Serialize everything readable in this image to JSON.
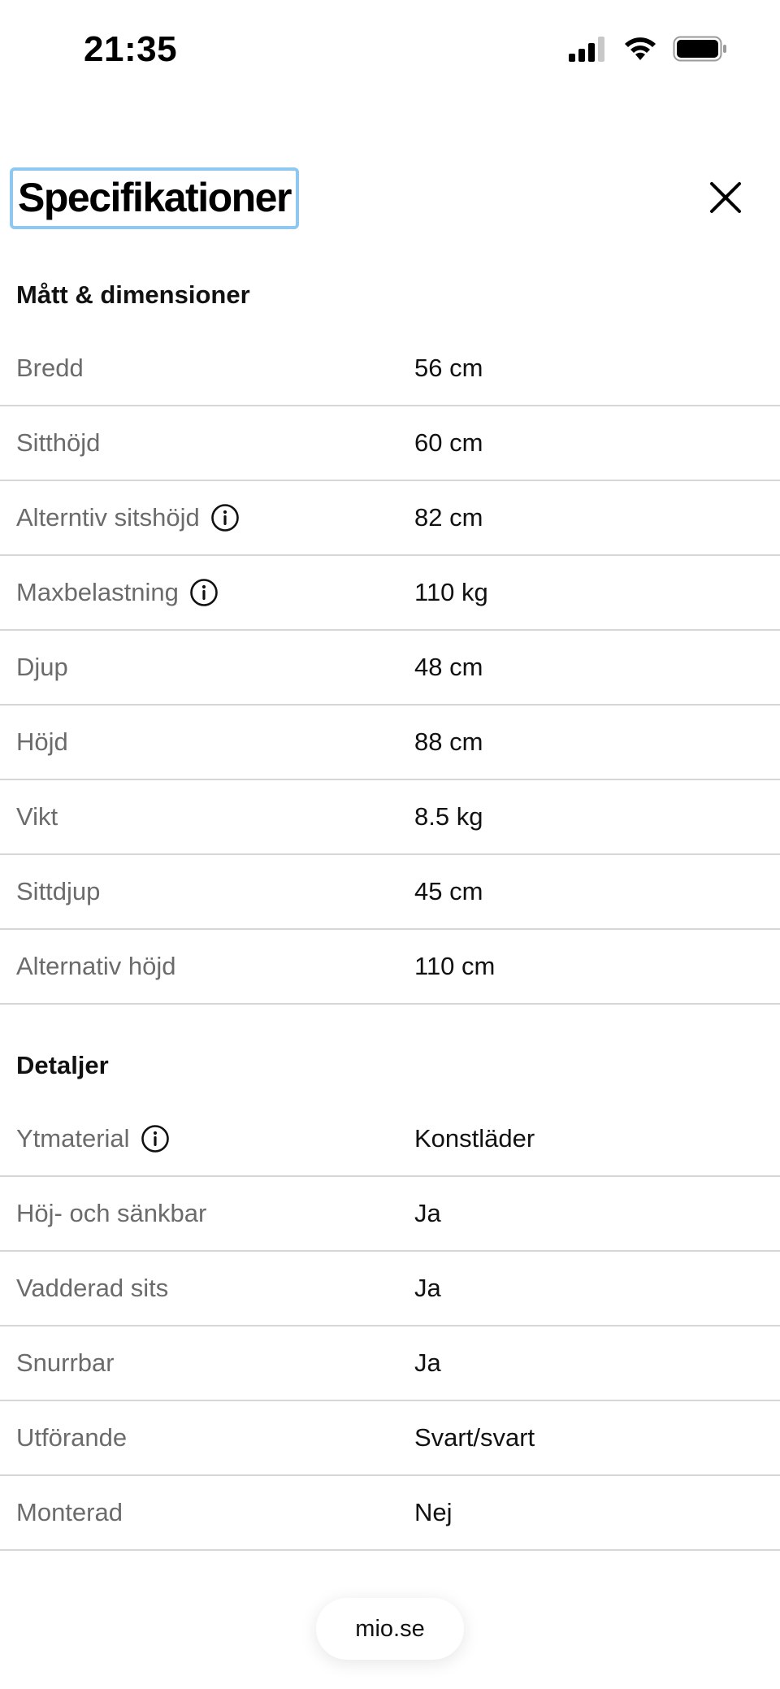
{
  "status_bar": {
    "time": "21:35",
    "icons": [
      "signal-icon",
      "wifi-icon",
      "battery-icon"
    ]
  },
  "header": {
    "title": "Specifikationer",
    "close_icon": "close-icon"
  },
  "sections": [
    {
      "title": "Mått & dimensioner",
      "rows": [
        {
          "label": "Bredd",
          "value": "56 cm",
          "info": false
        },
        {
          "label": "Sitthöjd",
          "value": "60 cm",
          "info": false
        },
        {
          "label": "Alterntiv sitshöjd",
          "value": "82 cm",
          "info": true
        },
        {
          "label": "Maxbelastning",
          "value": "110 kg",
          "info": true
        },
        {
          "label": "Djup",
          "value": "48 cm",
          "info": false
        },
        {
          "label": "Höjd",
          "value": "88 cm",
          "info": false
        },
        {
          "label": "Vikt",
          "value": "8.5 kg",
          "info": false
        },
        {
          "label": "Sittdjup",
          "value": "45 cm",
          "info": false
        },
        {
          "label": "Alternativ höjd",
          "value": "110 cm",
          "info": false
        }
      ]
    },
    {
      "title": "Detaljer",
      "rows": [
        {
          "label": "Ytmaterial",
          "value": "Konstläder",
          "info": true
        },
        {
          "label": "Höj- och sänkbar",
          "value": "Ja",
          "info": false
        },
        {
          "label": "Vadderad sits",
          "value": "Ja",
          "info": false
        },
        {
          "label": "Snurrbar",
          "value": "Ja",
          "info": false
        },
        {
          "label": "Utförande",
          "value": "Svart/svart",
          "info": false
        },
        {
          "label": "Monterad",
          "value": "Nej",
          "info": false
        }
      ]
    }
  ],
  "footer": {
    "url": "mio.se"
  },
  "colors": {
    "title_focus_border": "#8ec7f0",
    "label_text": "#6b6b6b",
    "value_text": "#111111",
    "divider": "#d6d6d6"
  }
}
